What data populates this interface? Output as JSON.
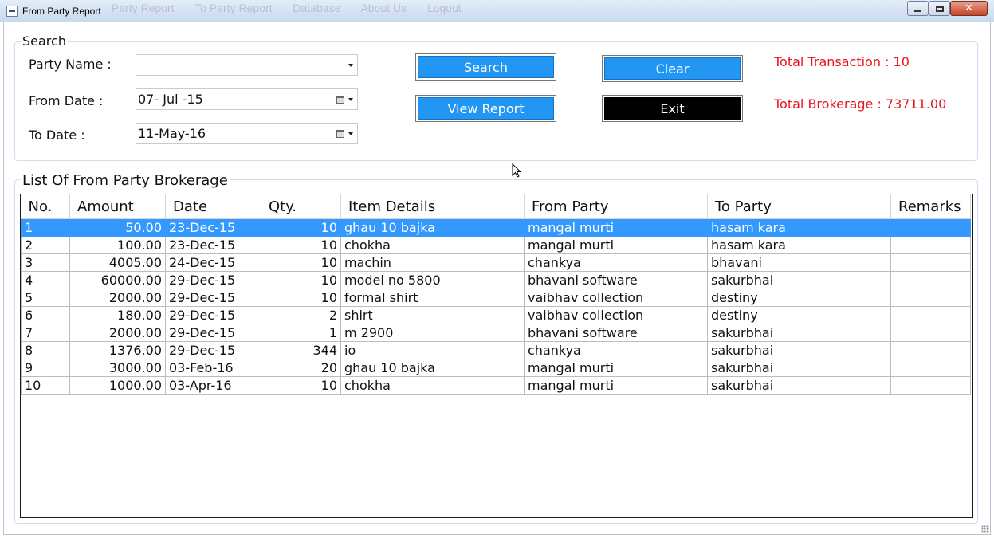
{
  "window": {
    "title": "From Party Report",
    "background_menu": [
      "Party Report",
      "To Party Report",
      "Database",
      "About Us",
      "Logout"
    ]
  },
  "search": {
    "group_label": "Search",
    "party_name_label": "Party Name :",
    "party_name_value": "",
    "from_date_label": "From Date :",
    "from_date_value": "07- Jul -15",
    "to_date_label": "To Date :",
    "to_date_value": "11-May-16",
    "search_button": "Search",
    "view_report_button": "View Report",
    "clear_button": "Clear",
    "exit_button": "Exit",
    "total_transaction": "Total Transaction : 10",
    "total_brokerage": "Total Brokerage : 73711.00"
  },
  "list": {
    "group_label": "List Of From Party Brokerage",
    "columns": [
      "No.",
      "Amount",
      "Date",
      "Qty.",
      "Item Details",
      "From Party",
      "To Party",
      "Remarks"
    ],
    "selected_row": 0,
    "rows": [
      {
        "no": "1",
        "amount": "50.00",
        "date": "23-Dec-15",
        "qty": "10",
        "item": "ghau 10 bajka",
        "from": "mangal murti",
        "to": "hasam kara",
        "remarks": ""
      },
      {
        "no": "2",
        "amount": "100.00",
        "date": "23-Dec-15",
        "qty": "10",
        "item": "chokha",
        "from": "mangal murti",
        "to": "hasam kara",
        "remarks": ""
      },
      {
        "no": "3",
        "amount": "4005.00",
        "date": "24-Dec-15",
        "qty": "10",
        "item": "machin",
        "from": "chankya",
        "to": "bhavani",
        "remarks": ""
      },
      {
        "no": "4",
        "amount": "60000.00",
        "date": "29-Dec-15",
        "qty": "10",
        "item": "model no 5800",
        "from": "bhavani software",
        "to": "sakurbhai",
        "remarks": ""
      },
      {
        "no": "5",
        "amount": "2000.00",
        "date": "29-Dec-15",
        "qty": "10",
        "item": "formal shirt",
        "from": "vaibhav collection",
        "to": "destiny",
        "remarks": ""
      },
      {
        "no": "6",
        "amount": "180.00",
        "date": "29-Dec-15",
        "qty": "2",
        "item": "shirt",
        "from": "vaibhav collection",
        "to": "destiny",
        "remarks": ""
      },
      {
        "no": "7",
        "amount": "2000.00",
        "date": "29-Dec-15",
        "qty": "1",
        "item": "m 2900",
        "from": "bhavani software",
        "to": "sakurbhai",
        "remarks": ""
      },
      {
        "no": "8",
        "amount": "1376.00",
        "date": "29-Dec-15",
        "qty": "344",
        "item": "io",
        "from": "chankya",
        "to": "sakurbhai",
        "remarks": ""
      },
      {
        "no": "9",
        "amount": "3000.00",
        "date": "03-Feb-16",
        "qty": "20",
        "item": "ghau 10 bajka",
        "from": "mangal murti",
        "to": "sakurbhai",
        "remarks": ""
      },
      {
        "no": "10",
        "amount": "1000.00",
        "date": "03-Apr-16",
        "qty": "10",
        "item": "chokha",
        "from": "mangal murti",
        "to": "sakurbhai",
        "remarks": ""
      }
    ]
  },
  "colors": {
    "button_blue": "#2196f3",
    "selection_blue": "#3399ff",
    "stat_red": "#e8141b"
  }
}
